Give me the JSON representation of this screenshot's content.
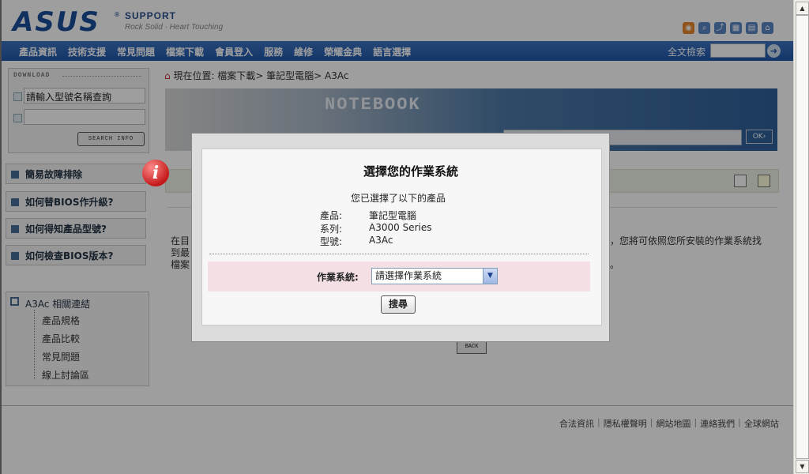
{
  "header": {
    "logo": "ASUS",
    "support": "SUPPORT",
    "slogan": "Rock Solid · Heart Touching",
    "logo_tm": "®"
  },
  "nav": {
    "items": [
      "產品資訊",
      "技術支援",
      "常見問題",
      "檔案下載",
      "會員登入",
      "服務",
      "維修",
      "榮耀金典",
      "語言選擇"
    ],
    "search_label": "全文檢索"
  },
  "sidebar": {
    "download_label": "DOWNLOAD",
    "model_input_value": "請輸入型號名稱查詢",
    "search_info_label": "SEARCH INFO",
    "faq": [
      "簡易故障排除",
      "如何替BIOS作升級?",
      "如何得知產品型號?",
      "如何檢查BIOS版本?"
    ],
    "related_title": "A3Ac 相關連結",
    "related_items": [
      "產品規格",
      "產品比較",
      "常見問題",
      "線上討論區"
    ]
  },
  "main": {
    "breadcrumb": "現在位置: 檔案下載> 筆記型電腦> A3Ac",
    "banner_text": "NOTEBOOK",
    "banner_ok": "OK›",
    "partial_text_left_1": "在目",
    "partial_text_left_2": "到最",
    "partial_text_left_3": "檔案",
    "partial_text_right_1": "，您將可依照您所安裝的作業系統找",
    "partial_text_right_2": "。",
    "back_label": "BACK"
  },
  "dialog": {
    "title": "選擇您的作業系統",
    "subtitle": "您已選擇了以下的產品",
    "fields": [
      {
        "key": "產品:",
        "value": "筆記型電腦"
      },
      {
        "key": "系列:",
        "value": "A3000 Series"
      },
      {
        "key": "型號:",
        "value": "A3Ac"
      }
    ],
    "os_label": "作業系統:",
    "os_selected": "請選擇作業系統",
    "search_button": "搜尋"
  },
  "footer": {
    "links": [
      "合法資訊",
      "隱私權聲明",
      "網站地圖",
      "連絡我們",
      "全球網站"
    ]
  }
}
